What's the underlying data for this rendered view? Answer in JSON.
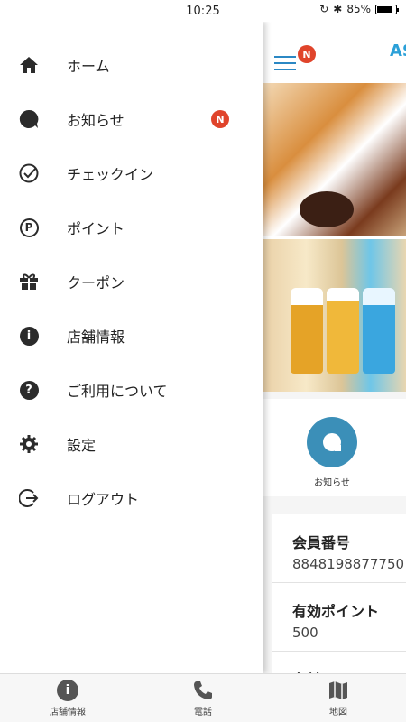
{
  "status_bar": {
    "time": "10:25",
    "battery": "85%",
    "battery_level": 0.85
  },
  "main": {
    "badge": "N",
    "logo_text": "AS",
    "notice_label": "お知らせ",
    "cards": [
      {
        "title": "会員番号",
        "value": "8848198877750"
      },
      {
        "title": "有効ポイント",
        "value": "500"
      },
      {
        "title": "名前",
        "value": ""
      }
    ]
  },
  "drawer": {
    "items": [
      {
        "label": "ホーム",
        "icon": "home-icon"
      },
      {
        "label": "お知らせ",
        "icon": "chat-bubble-icon",
        "badge": "N"
      },
      {
        "label": "チェックイン",
        "icon": "check-circle-icon"
      },
      {
        "label": "ポイント",
        "icon": "point-icon"
      },
      {
        "label": "クーポン",
        "icon": "gift-icon"
      },
      {
        "label": "店舗情報",
        "icon": "info-icon"
      },
      {
        "label": "ご利用について",
        "icon": "help-icon"
      },
      {
        "label": "設定",
        "icon": "gear-icon"
      },
      {
        "label": "ログアウト",
        "icon": "logout-icon"
      }
    ]
  },
  "tabbar": {
    "items": [
      {
        "label": "店舗情報",
        "icon": "info-icon"
      },
      {
        "label": "電話",
        "icon": "phone-icon"
      },
      {
        "label": "地図",
        "icon": "map-icon"
      }
    ]
  },
  "colors": {
    "accent": "#2b88c4",
    "badge": "#e0442b",
    "notice_circle": "#3b8fb8"
  }
}
